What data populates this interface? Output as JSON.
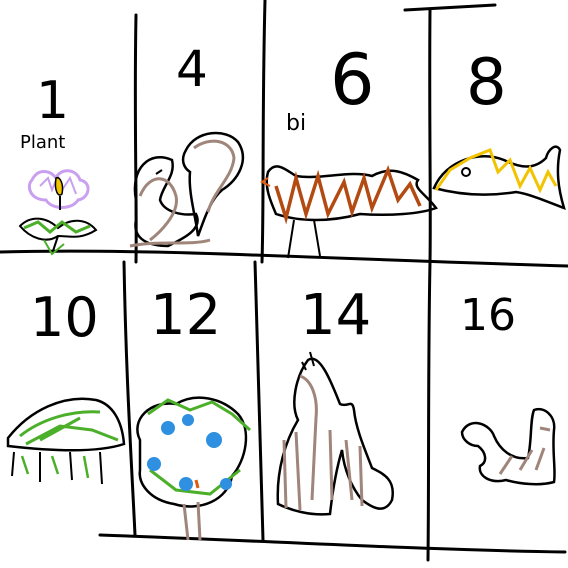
{
  "drawing": {
    "labels": {
      "c1": "1",
      "c1_word": "Plant",
      "c2": "4",
      "c3": "6",
      "c3_word": "bi",
      "c4": "8",
      "c5": "10",
      "c6": "12",
      "c7": "14",
      "c8": "16"
    },
    "colors": {
      "ink": "#000000",
      "purple": "#c9a0f0",
      "green": "#4caf2a",
      "yellow": "#f2c300",
      "brown": "#a0857a",
      "rust": "#b34a12",
      "blue": "#2f8fe0",
      "orange": "#e05a10"
    },
    "icons": [
      "flower-icon",
      "squirrel-icon",
      "bird-icon",
      "fish-icon",
      "turtle-icon",
      "tree-icon",
      "horse-icon",
      "seal-icon"
    ]
  }
}
